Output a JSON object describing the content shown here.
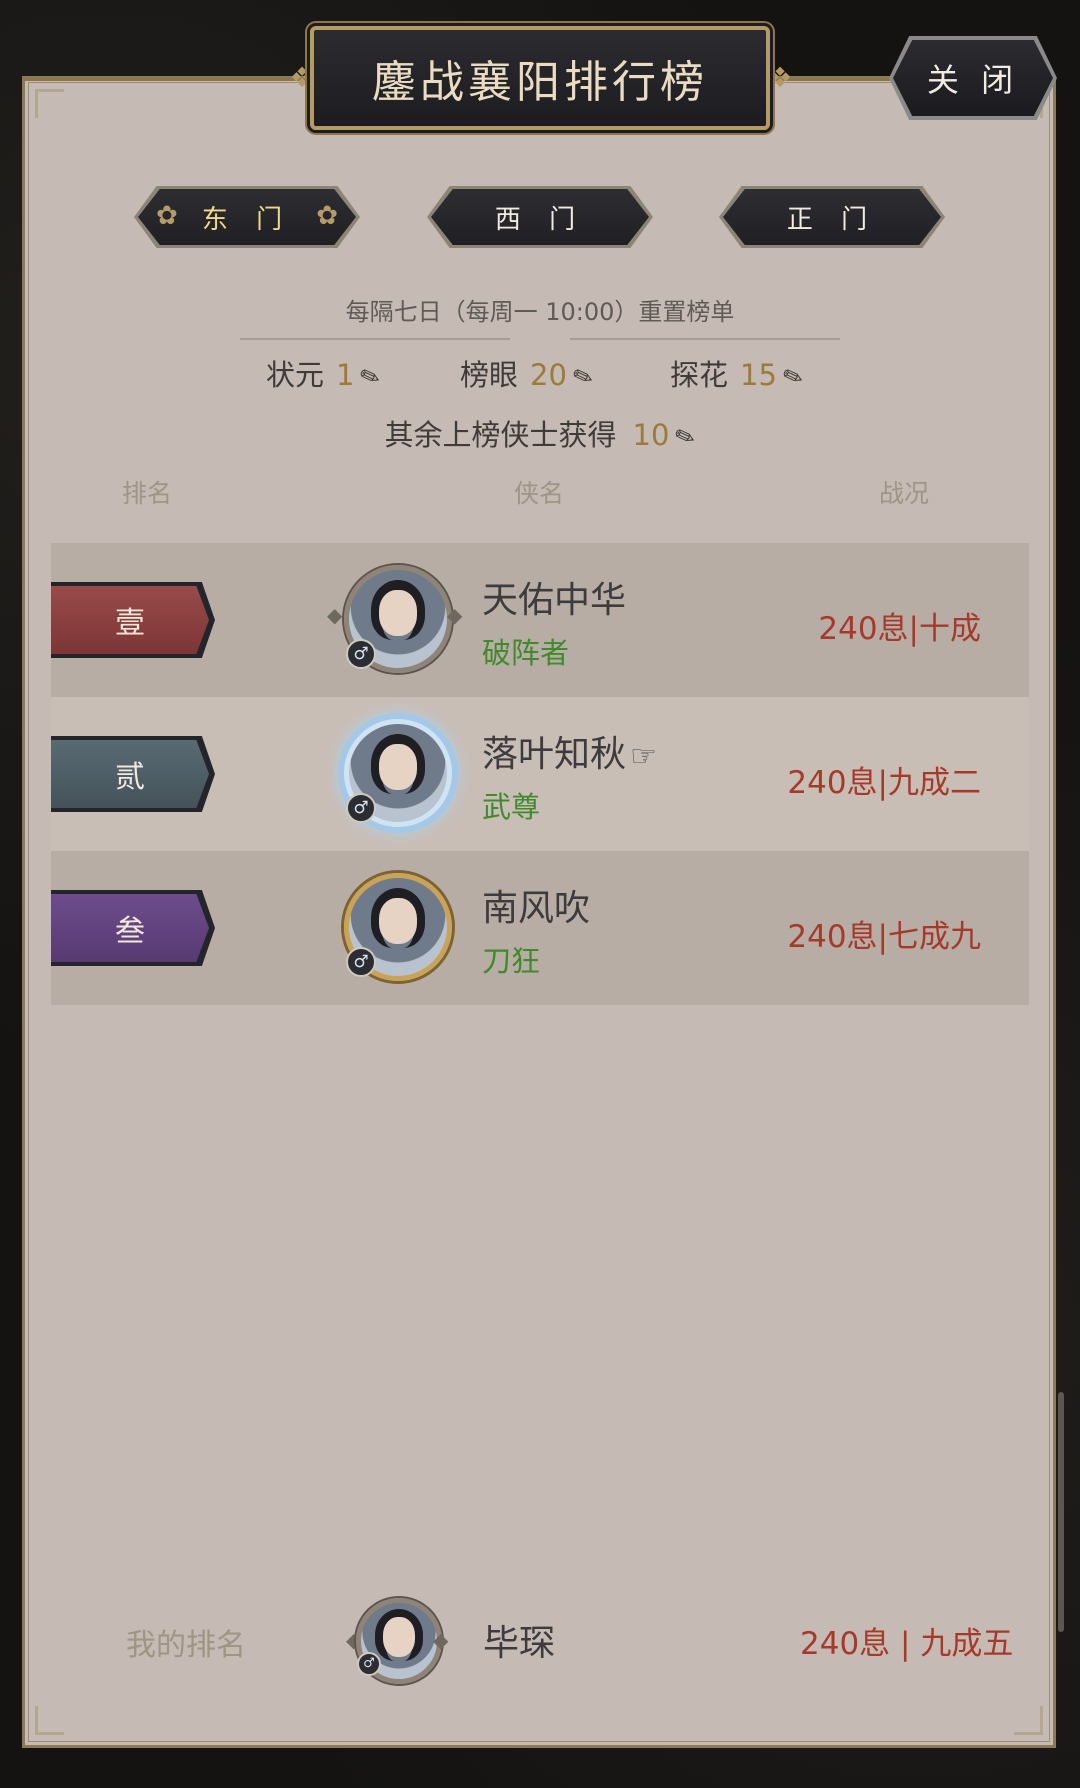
{
  "title": "鏖战襄阳排行榜",
  "close_label": "关 闭",
  "tabs": [
    {
      "label": "东 门",
      "active": true
    },
    {
      "label": "西 门",
      "active": false
    },
    {
      "label": "正 门",
      "active": false
    }
  ],
  "reset_note": "每隔七日（每周一 10:00）重置榜单",
  "rewards": [
    {
      "label": "状元",
      "value": "1"
    },
    {
      "label": "榜眼",
      "value": "20"
    },
    {
      "label": "探花",
      "value": "15"
    }
  ],
  "rest_reward": {
    "label": "其余上榜侠士获得",
    "value": "10"
  },
  "columns": {
    "rank": "排名",
    "name": "侠名",
    "record": "战况"
  },
  "rows": [
    {
      "rank": "壹",
      "name": "天佑中华",
      "title": "破阵者",
      "record": "240息|十成",
      "rank_color": "#8c4040"
    },
    {
      "rank": "贰",
      "name": "落叶知秋",
      "title": "武尊",
      "record": "240息|九成二",
      "rank_color": "#4f5f67"
    },
    {
      "rank": "叁",
      "name": "南风吹",
      "title": "刀狂",
      "record": "240息|七成九",
      "rank_color": "#634380"
    }
  ],
  "icons": {
    "currency": "feather-icon",
    "gender": "male-icon",
    "pointer": "pointing-hand-icon"
  },
  "colors": {
    "panel_bg": "#c5bab4",
    "record_red": "#a53a2a",
    "title_green": "#3f8a2a",
    "active_tab_text": "#f0d98a"
  },
  "my_rank": {
    "label": "我的排名",
    "name": "毕琛",
    "record": "240息 | 九成五"
  }
}
